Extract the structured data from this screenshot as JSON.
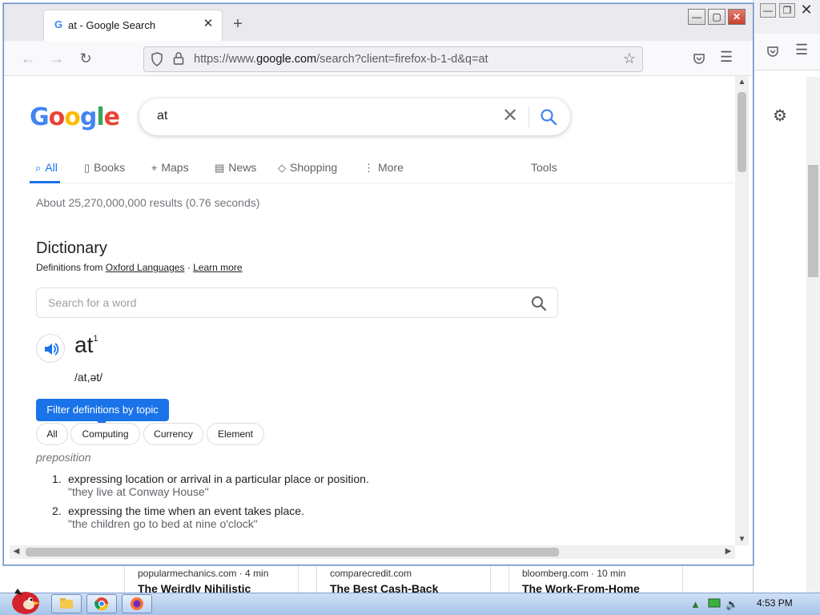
{
  "browser": {
    "tab_title": "at - Google Search",
    "tab_favicon": "G",
    "url_prefix": "https://www.",
    "url_domain": "google.com",
    "url_suffix": "/search?client=firefox-b-1-d&q=at"
  },
  "search": {
    "query": "at",
    "tabs": [
      {
        "label": "All",
        "icon": "search-icon"
      },
      {
        "label": "Books",
        "icon": "book-icon"
      },
      {
        "label": "Maps",
        "icon": "map-pin-icon"
      },
      {
        "label": "News",
        "icon": "news-icon"
      },
      {
        "label": "Shopping",
        "icon": "tag-icon"
      },
      {
        "label": "More",
        "icon": "more-vertical-icon"
      }
    ],
    "tools_label": "Tools",
    "result_stats": "About 25,270,000,000 results (0.76 seconds)"
  },
  "dictionary": {
    "title": "Dictionary",
    "source_prefix": "Definitions from ",
    "source_name": "Oxford Languages",
    "source_sep": " · ",
    "learn_more": "Learn more",
    "word_search_placeholder": "Search for a word",
    "headword": "at",
    "headword_sup": "1",
    "phonetic": "/at,ət/",
    "filter_tooltip": "Filter definitions by topic",
    "chips": [
      "All",
      "Computing",
      "Currency",
      "Element"
    ],
    "part_of_speech": "preposition",
    "definitions": [
      {
        "num": "1.",
        "text": "expressing location or arrival in a particular place or position.",
        "example": "\"they live at Conway House\""
      },
      {
        "num": "2.",
        "text": "expressing the time when an event takes place.",
        "example": "\"the children go to bed at nine o'clock\""
      }
    ]
  },
  "background_news": [
    {
      "source": "popularmechanics.com · 4 min",
      "title": "The Weirdly Nihilistic"
    },
    {
      "source": "comparecredit.com",
      "title": "The Best Cash-Back"
    },
    {
      "source": "bloomberg.com · 10 min",
      "title": "The Work-From-Home"
    }
  ],
  "taskbar": {
    "clock": "4:53 PM"
  },
  "colors": {
    "accent_blue": "#1a73e8",
    "google_blue": "#4285f4",
    "google_red": "#ea4335",
    "google_yellow": "#fbbc05",
    "google_green": "#34a853"
  }
}
